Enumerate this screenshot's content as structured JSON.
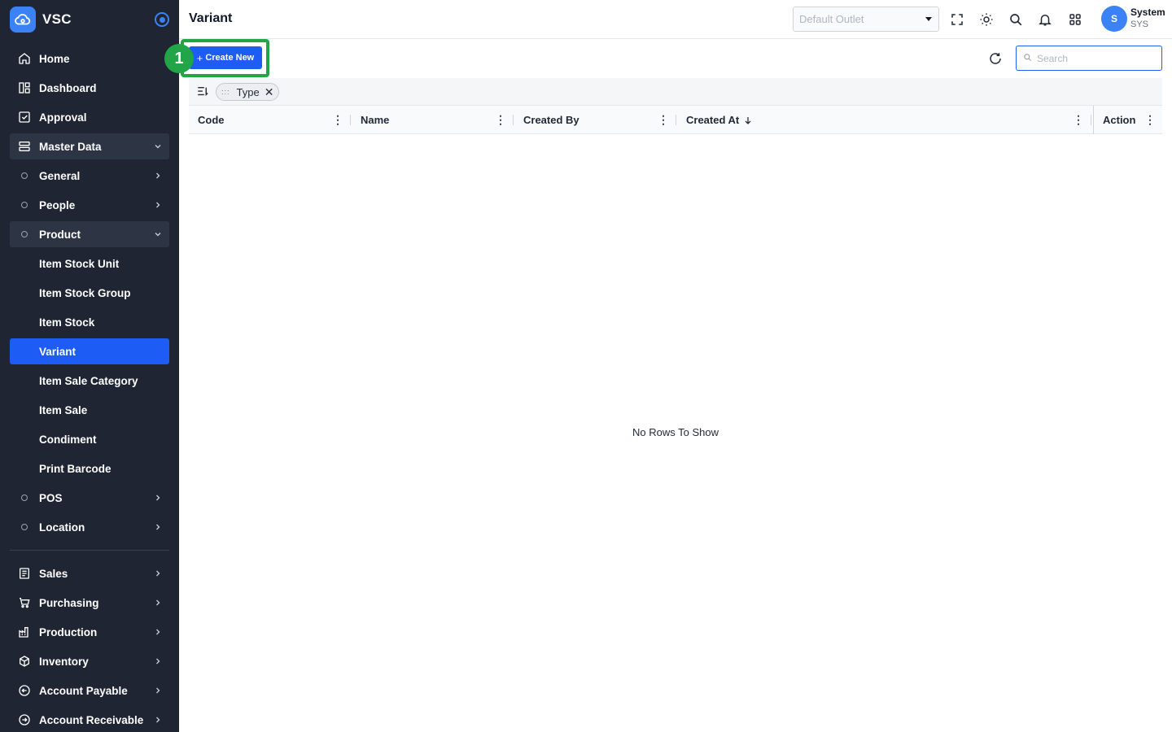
{
  "app": {
    "brand": "VSC"
  },
  "sidebar": {
    "items": [
      {
        "label": "Home",
        "icon": "home-icon"
      },
      {
        "label": "Dashboard",
        "icon": "dashboard-icon"
      },
      {
        "label": "Approval",
        "icon": "approval-icon"
      },
      {
        "label": "Master Data",
        "icon": "database-icon",
        "expanded": true
      },
      {
        "label": "General",
        "icon": "circle-icon"
      },
      {
        "label": "People",
        "icon": "circle-icon"
      },
      {
        "label": "Product",
        "icon": "circle-icon",
        "expanded": true
      },
      {
        "label": "Item Stock Unit"
      },
      {
        "label": "Item Stock Group"
      },
      {
        "label": "Item Stock"
      },
      {
        "label": "Variant",
        "active": true
      },
      {
        "label": "Item Sale Category"
      },
      {
        "label": "Item Sale"
      },
      {
        "label": "Condiment"
      },
      {
        "label": "Print Barcode"
      },
      {
        "label": "POS",
        "icon": "circle-icon"
      },
      {
        "label": "Location",
        "icon": "circle-icon"
      },
      {
        "label": "Sales",
        "icon": "sales-icon"
      },
      {
        "label": "Purchasing",
        "icon": "cart-icon"
      },
      {
        "label": "Production",
        "icon": "factory-icon"
      },
      {
        "label": "Inventory",
        "icon": "box-icon"
      },
      {
        "label": "Account Payable",
        "icon": "arrow-left-circle-icon"
      },
      {
        "label": "Account Receivable",
        "icon": "arrow-right-circle-icon"
      }
    ]
  },
  "header": {
    "title": "Variant",
    "outlet_placeholder": "Default Outlet",
    "user": {
      "initial": "S",
      "name": "System",
      "code": "SYS"
    }
  },
  "toolbar": {
    "create_label": "Create New",
    "search_placeholder": "Search",
    "step_badge": "1"
  },
  "group_bar": {
    "chip_label": "Type"
  },
  "table": {
    "columns": [
      "Code",
      "Name",
      "Created By",
      "Created At",
      "Action"
    ],
    "sorted_column": "Created At",
    "sort_direction": "desc",
    "empty_message": "No Rows To Show"
  },
  "colors": {
    "sidebar_bg": "#1f2533",
    "accent": "#1d5cf5",
    "highlight": "#22a547"
  }
}
